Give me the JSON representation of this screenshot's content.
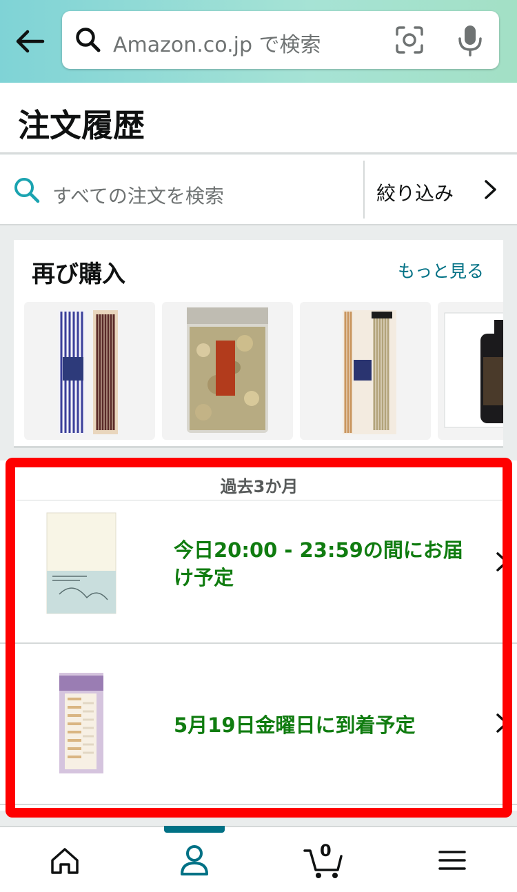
{
  "header": {
    "search_placeholder": "Amazon.co.jp で検索",
    "icons": [
      "back-arrow-icon",
      "search-icon",
      "camera-icon",
      "microphone-icon"
    ]
  },
  "page": {
    "title": "注文履歴"
  },
  "order_search": {
    "placeholder": "すべての注文を検索",
    "filter_label": "絞り込み"
  },
  "buy_again": {
    "title": "再び購入",
    "more_link": "もっと見る",
    "items": [
      "incense-sticks-blue",
      "almond-fish-snack-bag",
      "incense-sticks-beige",
      "dark-bottle"
    ]
  },
  "orders": {
    "period_label": "過去3か月",
    "items": [
      {
        "status": "今日20:00 - 23:59の間にお届け予定",
        "product_image": "notebook"
      },
      {
        "status": "5月19日金曜日に到着予定",
        "product_image": "index-tabs"
      }
    ]
  },
  "bottom_nav": {
    "items": [
      "home-icon",
      "account-icon",
      "cart-icon",
      "menu-icon"
    ],
    "active": "account-icon",
    "cart_count": "0"
  },
  "colors": {
    "accent": "#007185",
    "status_green": "#107c10",
    "highlight_red": "#ff0000"
  }
}
